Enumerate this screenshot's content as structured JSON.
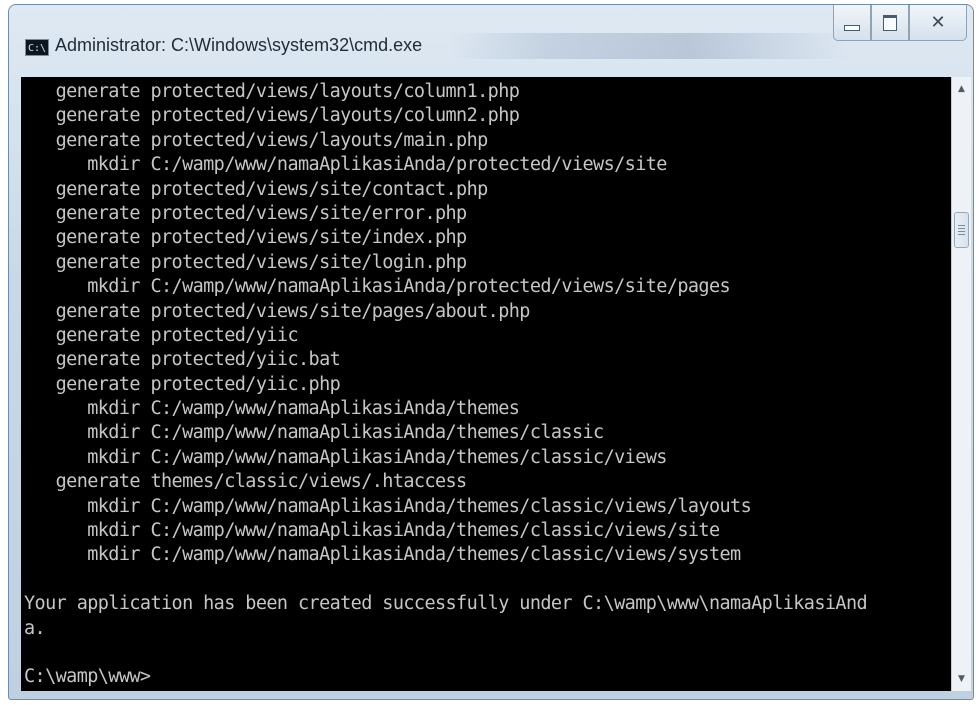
{
  "window": {
    "title": "Administrator: C:\\Windows\\system32\\cmd.exe",
    "app_icon_label": "C:\\",
    "app_icon": "console-icon"
  },
  "controls": {
    "minimize_icon": "minimize-icon",
    "maximize_icon": "maximize-icon",
    "close_icon": "close-icon",
    "close_glyph": "✕"
  },
  "console": {
    "background": "#000000",
    "text_color": "#c6c6c6",
    "lines": [
      "   generate protected/views/layouts/column1.php",
      "   generate protected/views/layouts/column2.php",
      "   generate protected/views/layouts/main.php",
      "      mkdir C:/wamp/www/namaAplikasiAnda/protected/views/site",
      "   generate protected/views/site/contact.php",
      "   generate protected/views/site/error.php",
      "   generate protected/views/site/index.php",
      "   generate protected/views/site/login.php",
      "      mkdir C:/wamp/www/namaAplikasiAnda/protected/views/site/pages",
      "   generate protected/views/site/pages/about.php",
      "   generate protected/yiic",
      "   generate protected/yiic.bat",
      "   generate protected/yiic.php",
      "      mkdir C:/wamp/www/namaAplikasiAnda/themes",
      "      mkdir C:/wamp/www/namaAplikasiAnda/themes/classic",
      "      mkdir C:/wamp/www/namaAplikasiAnda/themes/classic/views",
      "   generate themes/classic/views/.htaccess",
      "      mkdir C:/wamp/www/namaAplikasiAnda/themes/classic/views/layouts",
      "      mkdir C:/wamp/www/namaAplikasiAnda/themes/classic/views/site",
      "      mkdir C:/wamp/www/namaAplikasiAnda/themes/classic/views/system",
      "",
      "Your application has been created successfully under C:\\wamp\\www\\namaAplikasiAnd",
      "a.",
      "",
      "C:\\wamp\\www>"
    ]
  },
  "scrollbar": {
    "up_glyph": "▲",
    "down_glyph": "▼"
  }
}
